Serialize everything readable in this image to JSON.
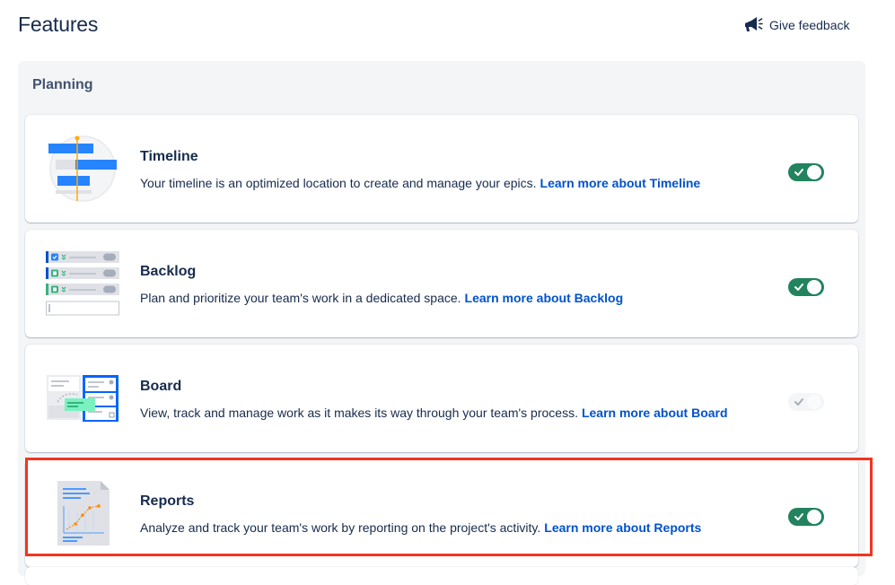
{
  "page": {
    "title": "Features"
  },
  "feedback": {
    "label": "Give feedback",
    "icon": "megaphone-icon"
  },
  "section": {
    "title": "Planning"
  },
  "colors": {
    "toggle_on": "#22835E",
    "link": "#0052CC",
    "highlight": "#F5341F"
  },
  "features": [
    {
      "name": "Timeline",
      "description": "Your timeline is an optimized location to create and manage your epics.",
      "link": "Learn more about Timeline",
      "enabled": true
    },
    {
      "name": "Backlog",
      "description": "Plan and prioritize your team's work in a dedicated space.",
      "link": "Learn more about Backlog",
      "enabled": true
    },
    {
      "name": "Board",
      "description": "View, track and manage work as it makes its way through your team's process.",
      "link": "Learn more about Board",
      "enabled": true,
      "disabled": true
    },
    {
      "name": "Reports",
      "description": "Analyze and track your team's work by reporting on the project's activity.",
      "link": "Learn more about Reports",
      "enabled": true,
      "highlighted": true
    }
  ]
}
